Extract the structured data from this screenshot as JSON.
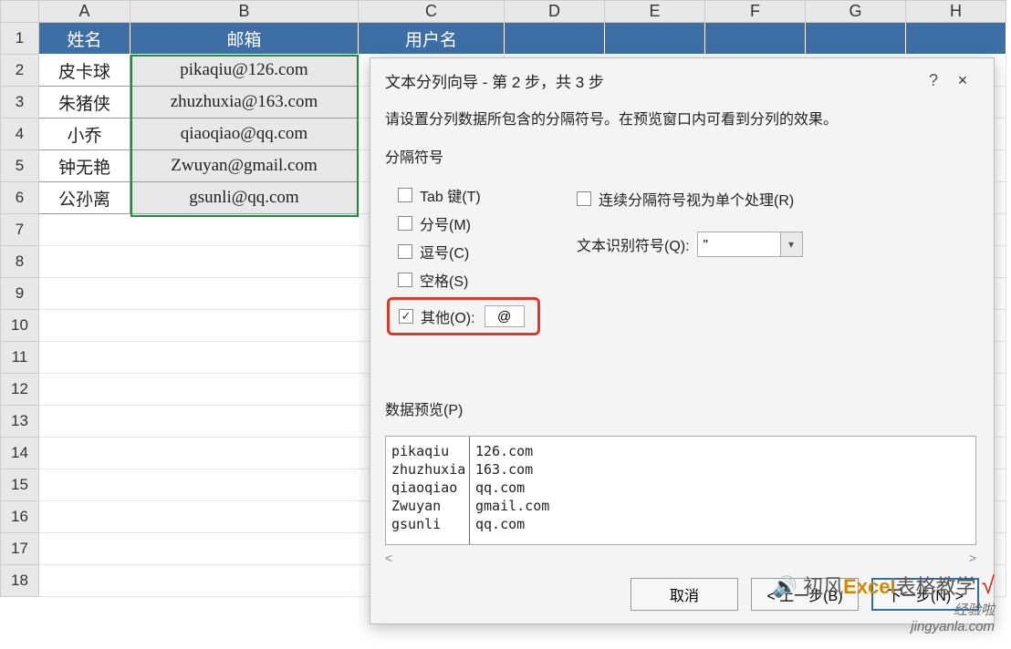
{
  "sheet": {
    "columns": [
      "A",
      "B",
      "C",
      "D",
      "E",
      "F",
      "G",
      "H"
    ],
    "row_numbers": [
      1,
      2,
      3,
      4,
      5,
      6,
      7,
      8,
      9,
      10,
      11,
      12,
      13,
      14,
      15,
      16,
      17,
      18
    ],
    "header_row": {
      "name": "姓名",
      "email": "邮箱",
      "user": "用户名"
    },
    "rows": [
      {
        "name": "皮卡球",
        "email": "pikaqiu@126.com"
      },
      {
        "name": "朱猪侠",
        "email": "zhuzhuxia@163.com"
      },
      {
        "name": "小乔",
        "email": "qiaoqiao@qq.com"
      },
      {
        "name": "钟无艳",
        "email": "Zwuyan@gmail.com"
      },
      {
        "name": "公孙离",
        "email": "gsunli@qq.com"
      }
    ]
  },
  "dialog": {
    "title": "文本分列向导 - 第 2 步，共 3 步",
    "help": "?",
    "close": "×",
    "description": "请设置分列数据所包含的分隔符号。在预览窗口内可看到分列的效果。",
    "group_label": "分隔符号",
    "delimiters": {
      "tab": {
        "label": "Tab 键(T)",
        "checked": false
      },
      "semicolon": {
        "label": "分号(M)",
        "checked": false
      },
      "comma": {
        "label": "逗号(C)",
        "checked": false
      },
      "space": {
        "label": "空格(S)",
        "checked": false
      },
      "other": {
        "label": "其他(O):",
        "checked": true,
        "value": "@"
      }
    },
    "treat_consecutive": {
      "label": "连续分隔符号视为单个处理(R)",
      "checked": false
    },
    "text_qualifier": {
      "label": "文本识别符号(Q):",
      "value": "\""
    },
    "preview_label": "数据预览(P)",
    "preview": {
      "col1": [
        "pikaqiu",
        "zhuzhuxia",
        "qiaoqiao",
        "Zwuyan",
        "gsunli"
      ],
      "col2": [
        "126.com",
        "163.com",
        "qq.com",
        "gmail.com",
        "qq.com"
      ]
    },
    "scroll_left": "<",
    "scroll_right": ">",
    "buttons": {
      "cancel": "取消",
      "back": "< 上一步(B)",
      "next": "下一步(N) >"
    }
  },
  "watermark": {
    "line1_a": "初风",
    "line1_b": "Excel",
    "line1_c": "表格教学",
    "line1_prefix": "🔊",
    "line1_suffix": "√",
    "line2": "经验啦",
    "line3": "jingyanla.com"
  }
}
